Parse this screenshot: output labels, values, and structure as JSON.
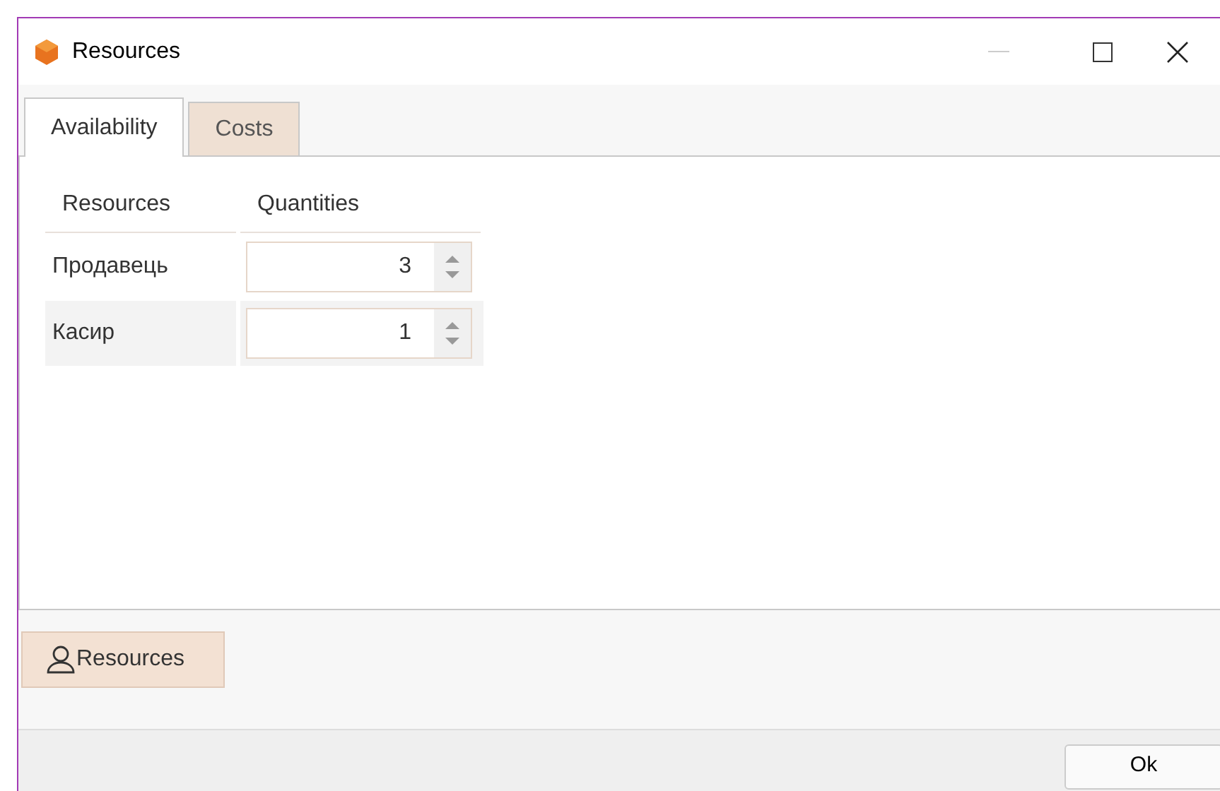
{
  "window": {
    "title": "Resources"
  },
  "tabs": [
    {
      "label": "Availability",
      "selected": true
    },
    {
      "label": "Costs",
      "selected": false
    }
  ],
  "table": {
    "columns": [
      "Resources",
      "Quantities"
    ],
    "rows": [
      {
        "resource": "Продавець",
        "quantity": "3",
        "selected": false
      },
      {
        "resource": "Касир",
        "quantity": "1",
        "selected": true
      }
    ]
  },
  "resources_button": "Resources",
  "ok_button": "Ok"
}
